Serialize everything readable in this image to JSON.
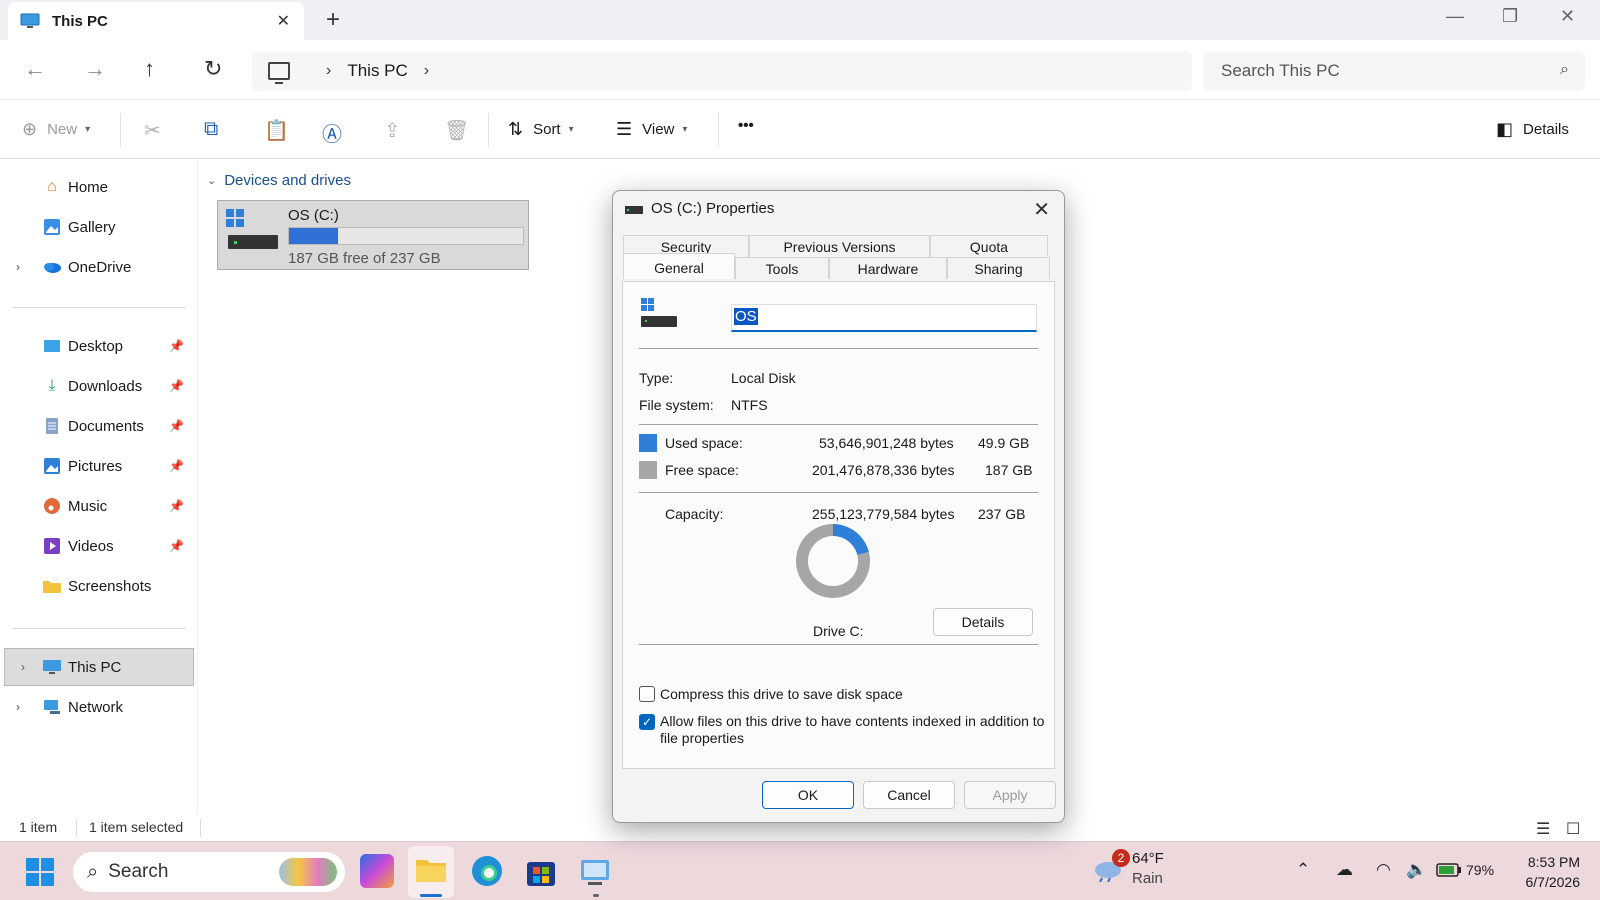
{
  "window": {
    "tab_title": "This PC",
    "new_tab": "+",
    "minimize": "—",
    "maximize": "❐",
    "close": "✕"
  },
  "address": {
    "crumb": "This PC",
    "search_placeholder": "Search This PC"
  },
  "command_bar": {
    "new_label": "New",
    "sort_label": "Sort",
    "view_label": "View",
    "more_label": "•••",
    "details_label": "Details"
  },
  "sidebar": {
    "top_items": [
      {
        "label": "Home",
        "icon": "home-icon"
      },
      {
        "label": "Gallery",
        "icon": "gallery-icon"
      },
      {
        "label": "OneDrive",
        "icon": "onedrive-icon"
      }
    ],
    "pinned_items": [
      {
        "label": "Desktop",
        "icon": "desktop-icon"
      },
      {
        "label": "Downloads",
        "icon": "downloads-icon"
      },
      {
        "label": "Documents",
        "icon": "documents-icon"
      },
      {
        "label": "Pictures",
        "icon": "pictures-icon"
      },
      {
        "label": "Music",
        "icon": "music-icon"
      },
      {
        "label": "Videos",
        "icon": "videos-icon"
      },
      {
        "label": "Screenshots",
        "icon": "folder-icon"
      }
    ],
    "bottom_items": [
      {
        "label": "This PC",
        "icon": "this-pc-icon",
        "selected": true
      },
      {
        "label": "Network",
        "icon": "network-icon"
      }
    ]
  },
  "content": {
    "group_header": "Devices and drives",
    "drive": {
      "name": "OS (C:)",
      "free_text": "187 GB free of 237 GB",
      "used_fraction": 0.21
    }
  },
  "status": {
    "items": "1 item",
    "selected": "1 item selected"
  },
  "dialog": {
    "title": "OS (C:) Properties",
    "tabs_back": [
      "Security",
      "Previous Versions",
      "Quota"
    ],
    "tabs_front": [
      "General",
      "Tools",
      "Hardware",
      "Sharing"
    ],
    "active_tab": "General",
    "drive_name": "OS",
    "type_label": "Type:",
    "type_value": "Local Disk",
    "fs_label": "File system:",
    "fs_value": "NTFS",
    "used_label": "Used space:",
    "used_bytes": "53,646,901,248 bytes",
    "used_gb": "49.9 GB",
    "free_label": "Free space:",
    "free_bytes": "201,476,878,336 bytes",
    "free_gb": "187 GB",
    "capacity_label": "Capacity:",
    "capacity_bytes": "255,123,779,584 bytes",
    "capacity_gb": "237 GB",
    "used_fraction": 0.21,
    "drive_caption": "Drive C:",
    "details_button": "Details",
    "compress_label": "Compress this drive to save disk space",
    "compress_checked": false,
    "index_label_1": "Allow files on this drive to have contents indexed in addition to",
    "index_label_2": "file properties",
    "index_checked": true,
    "ok": "OK",
    "cancel": "Cancel",
    "apply": "Apply",
    "colors": {
      "used": "#2f7ed8",
      "free": "#a6a6a6"
    }
  },
  "taskbar": {
    "search_label": "Search",
    "weather_temp": "64°F",
    "weather_desc": "Rain",
    "weather_badge": "2",
    "battery": "79%",
    "time": "8:53 PM",
    "date": "6/7/2026"
  }
}
